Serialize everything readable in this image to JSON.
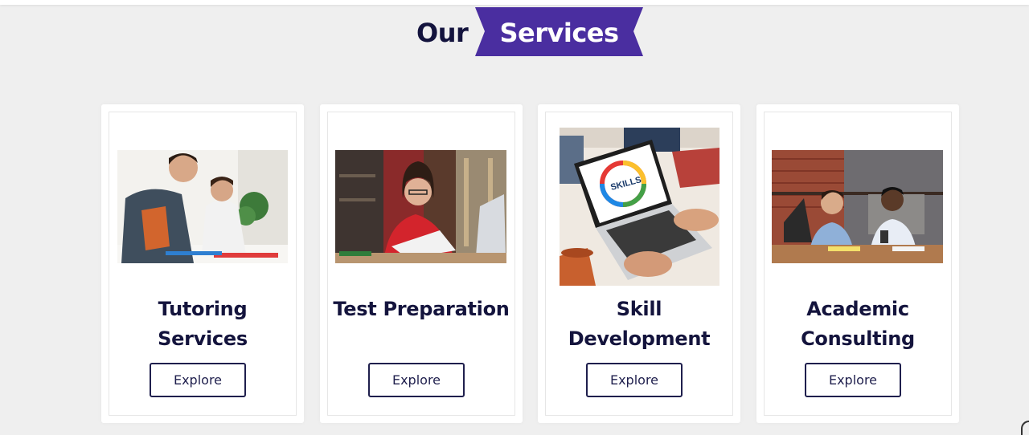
{
  "section": {
    "heading_plain": "Our",
    "heading_highlight": "Services"
  },
  "colors": {
    "accent": "#4a2ea0",
    "title": "#14143d",
    "background": "#efefef",
    "card": "#ffffff"
  },
  "cards": [
    {
      "title_line1": "Tutoring",
      "title_line2": "Services",
      "button": "Explore",
      "image": "tutoring-photo"
    },
    {
      "title_line1": "Test Preparation",
      "title_line2": "",
      "button": "Explore",
      "image": "test-prep-photo"
    },
    {
      "title_line1": "Skill",
      "title_line2": "Development",
      "button": "Explore",
      "image": "skills-laptop-photo",
      "image_label": "SKILLS"
    },
    {
      "title_line1": "Academic",
      "title_line2": "Consulting",
      "button": "Explore",
      "image": "consulting-photo"
    }
  ]
}
